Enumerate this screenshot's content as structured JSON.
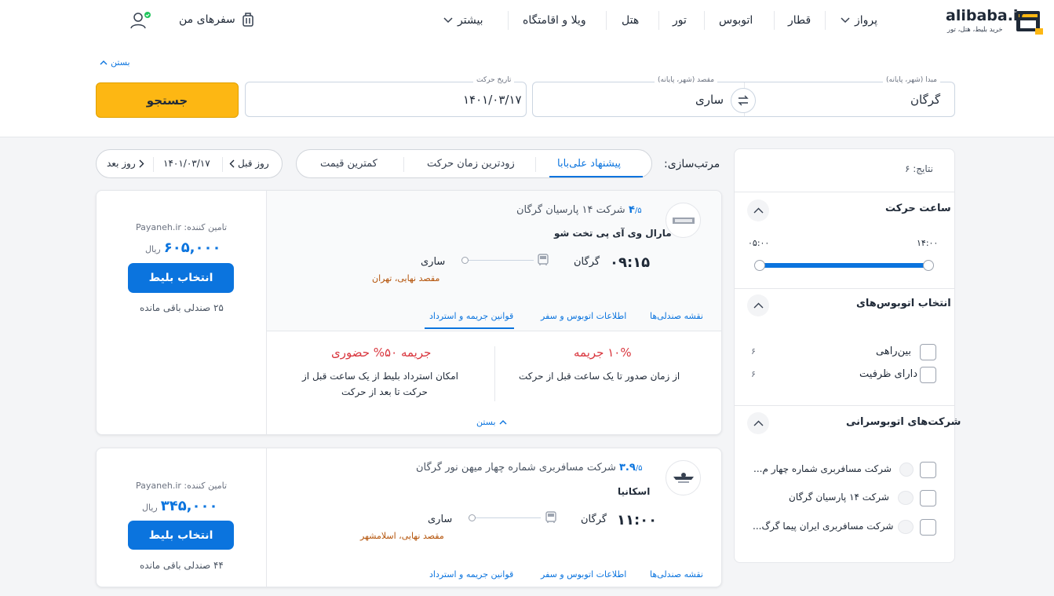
{
  "header": {
    "logo_text": "alibaba.ir",
    "logo_sub": "خرید بلیط، هتل، تور",
    "menu": [
      "پرواز",
      "قطار",
      "اتوبوس",
      "تور",
      "هتل",
      "ویلا و اقامتگاه",
      "بیشتر"
    ],
    "my_trips": "سفرهای من"
  },
  "search": {
    "collapse": "بستن",
    "origin_label": "مبدا (شهر، پایانه)",
    "origin": "گرگان",
    "dest_label": "مقصد (شهر، پایانه)",
    "dest": "ساری",
    "date_label": "تاریخ حرکت",
    "date": "۱۴۰۱/۰۳/۱۷",
    "button": "جستجو"
  },
  "sort": {
    "label": "مرتب‌سازی:",
    "options": [
      "پیشنهاد علی‌بابا",
      "زودترین زمان حرکت",
      "کمترین قیمت"
    ]
  },
  "day_nav": {
    "prev": "روز قبل",
    "date": "۱۴۰۱/۰۳/۱۷",
    "next": "روز بعد"
  },
  "results": [
    {
      "rating": "۴",
      "rating_of": "/۵",
      "company": "شرکت ۱۴ پارسیان گرگان",
      "bus": "مارال وی آی پی تخت شو",
      "time": "۰۹:۱۵",
      "origin": "گرگان",
      "dest": "ساری",
      "final_dest": "مقصد نهایی، تهران",
      "supplier": "تامین کننده: Payaneh.ir",
      "price": "۶۰۵,۰۰۰",
      "currency": "ریال",
      "select": "انتخاب بلیط",
      "seats": "۲۵ صندلی باقی مانده",
      "tabs": [
        "نقشه صندلی‌ها",
        "اطلاعات اتوبوس و سفر",
        "قوانین جریمه و استرداد"
      ],
      "penalty_a_title": "۱۰% جریمه",
      "penalty_a_text": "از زمان صدور تا یک ساعت قبل از حرکت",
      "penalty_b_title": "جریمه ۵۰% حضوری",
      "penalty_b_text1": "امکان استرداد بلیط از یک ساعت قبل از",
      "penalty_b_text2": "حرکت تا بعد از حرکت",
      "close": "بستن"
    },
    {
      "rating": "۳.۹",
      "rating_of": "/۵",
      "company": "شرکت مسافربری شماره چهار میهن نور گرگان",
      "bus": "اسکانیا",
      "time": "۱۱:۰۰",
      "origin": "گرگان",
      "dest": "ساری",
      "final_dest": "مقصد نهایی، اسلامشهر",
      "supplier": "تامین کننده: Payaneh.ir",
      "price": "۳۴۵,۰۰۰",
      "currency": "ریال",
      "select": "انتخاب بلیط",
      "seats": "۴۴ صندلی باقی مانده",
      "tabs": [
        "نقشه صندلی‌ها",
        "اطلاعات اتوبوس و سفر",
        "قوانین جریمه و استرداد"
      ]
    }
  ],
  "filters": {
    "results_count": "نتایج: ۶",
    "time_title": "ساعت حرکت",
    "time_from": "۰۵:۰۰",
    "time_to": "۱۴:۰۰",
    "bus_type_title": "انتخاب اتوبوس‌های",
    "bus_types": [
      {
        "label": "بین‌راهی",
        "count": "۶"
      },
      {
        "label": "دارای ظرفیت",
        "count": "۶"
      }
    ],
    "companies_title": "شرکت‌های اتوبوسرانی",
    "companies": [
      "شرکت مسافربری شماره چهار م...",
      "شرکت ۱۴ پارسیان گرگان",
      "شرکت مسافربری ایران پیما گرگ..."
    ]
  },
  "colors": {
    "accent": "#0b74de",
    "button_yellow": "#fdb713",
    "penalty_red": "#d9363e"
  }
}
